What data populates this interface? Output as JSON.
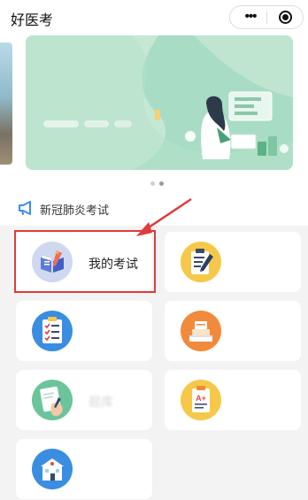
{
  "nav": {
    "title": "好医考",
    "more_icon": "more-dots-icon",
    "close_icon": "circle-target-icon"
  },
  "banner": {
    "pages": 2,
    "active_page": 2
  },
  "notice": {
    "icon": "megaphone-icon",
    "text": "新冠肺炎考试"
  },
  "grid": {
    "items": [
      {
        "label": "我的考试",
        "icon": "exam-book-icon",
        "highlighted": true
      },
      {
        "label": "",
        "icon": "clipboard-pen-icon"
      },
      {
        "label": "",
        "icon": "checklist-icon"
      },
      {
        "label": "",
        "icon": "book-stack-icon"
      },
      {
        "label": "题库",
        "icon": "writing-hand-icon",
        "faded": true
      },
      {
        "label": "",
        "icon": "grade-report-icon"
      },
      {
        "label": "",
        "icon": "school-building-icon"
      }
    ]
  },
  "colors": {
    "highlight": "#e03a3a",
    "banner_green": "#a9dcc4",
    "page_bg": "#f3f3f3"
  }
}
